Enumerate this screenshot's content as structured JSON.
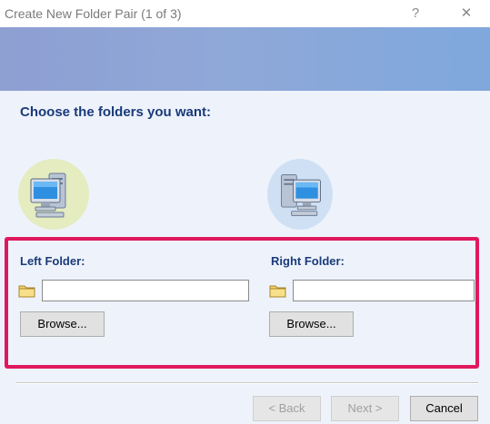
{
  "window": {
    "title": "Create New Folder Pair (1 of 3)",
    "help_label": "?",
    "close_label": "✕"
  },
  "content": {
    "heading": "Choose the folders you want:"
  },
  "left": {
    "label": "Left Folder:",
    "input_value": "",
    "browse_label": "Browse..."
  },
  "right": {
    "label": "Right Folder:",
    "input_value": "",
    "browse_label": "Browse..."
  },
  "footer": {
    "back_label": "< Back",
    "next_label": "Next >",
    "cancel_label": "Cancel"
  },
  "colors": {
    "highlight": "#e0185e",
    "heading": "#1a3a7a",
    "banner": "#8fa8d8"
  }
}
